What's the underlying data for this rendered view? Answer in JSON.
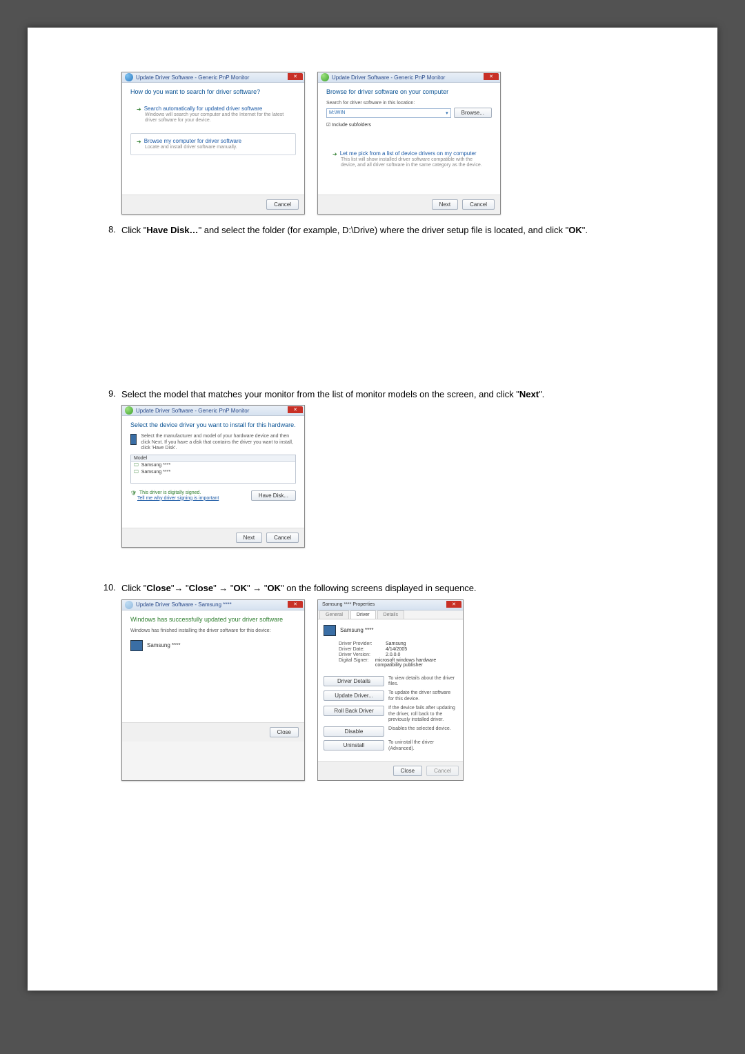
{
  "steps": {
    "s8": {
      "num": "8.",
      "text_a": "Click \"",
      "bold_a": "Have Disk…",
      "text_b": "\" and select the folder (for example, D:\\Drive) where the driver setup file is located, and click \"",
      "bold_b": "OK",
      "text_c": "\"."
    },
    "s9": {
      "num": "9.",
      "text_a": "Select the model that matches your monitor from the list of monitor models on the screen, and click \"",
      "bold_a": "Next",
      "text_b": "\"."
    },
    "s10": {
      "num": "10.",
      "text_a": "Click \"",
      "bold_a": "Close",
      "text_b": "\"→ \"",
      "bold_b": "Close",
      "text_c": "\" → \"",
      "bold_c": "OK",
      "text_d": "\" → \"",
      "bold_d": "OK",
      "text_e": "\" on the following screens displayed in sequence."
    }
  },
  "dlg1": {
    "title": "Update Driver Software - Generic PnP Monitor",
    "head": "How do you want to search for driver software?",
    "opt1_t": "Search automatically for updated driver software",
    "opt1_d": "Windows will search your computer and the Internet for the latest driver software for your device.",
    "opt2_t": "Browse my computer for driver software",
    "opt2_d": "Locate and install driver software manually.",
    "cancel": "Cancel"
  },
  "dlg2": {
    "title": "Update Driver Software - Generic PnP Monitor",
    "head": "Browse for driver software on your computer",
    "label": "Search for driver software in this location:",
    "path": "M:\\WIN",
    "browse": "Browse...",
    "chk": "Include subfolders",
    "opt_t": "Let me pick from a list of device drivers on my computer",
    "opt_d": "This list will show installed driver software compatible with the device, and all driver software in the same category as the device.",
    "next": "Next",
    "cancel": "Cancel"
  },
  "dlg3": {
    "title": "Update Driver Software - Generic PnP Monitor",
    "head": "Select the device driver you want to install for this hardware.",
    "sub": "Select the manufacturer and model of your hardware device and then click Next. If you have a disk that contains the driver you want to install, click 'Have Disk'.",
    "model_hdr": "Model",
    "model1": "Samsung ****",
    "model2": "Samsung ****",
    "signed": "This driver is digitally signed.",
    "signlink": "Tell me why driver signing is important",
    "havedisk": "Have Disk...",
    "next": "Next",
    "cancel": "Cancel"
  },
  "dlg4": {
    "title": "Update Driver Software - Samsung ****",
    "head": "Windows has successfully updated your driver software",
    "sub": "Windows has finished installing the driver software for this device:",
    "dev": "Samsung ****",
    "close": "Close"
  },
  "prop": {
    "title": "Samsung **** Properties",
    "tab_general": "General",
    "tab_driver": "Driver",
    "tab_details": "Details",
    "dev": "Samsung ****",
    "provider_k": "Driver Provider:",
    "provider_v": "Samsung",
    "date_k": "Driver Date:",
    "date_v": "4/14/2005",
    "ver_k": "Driver Version:",
    "ver_v": "2.0.0.0",
    "signer_k": "Digital Signer:",
    "signer_v": "microsoft windows hardware compatibility publisher",
    "b1": "Driver Details",
    "d1": "To view details about the driver files.",
    "b2": "Update Driver...",
    "d2": "To update the driver software for this device.",
    "b3": "Roll Back Driver",
    "d3": "If the device fails after updating the driver, roll back to the previously installed driver.",
    "b4": "Disable",
    "d4": "Disables the selected device.",
    "b5": "Uninstall",
    "d5": "To uninstall the driver (Advanced).",
    "close": "Close",
    "cancel": "Cancel"
  }
}
